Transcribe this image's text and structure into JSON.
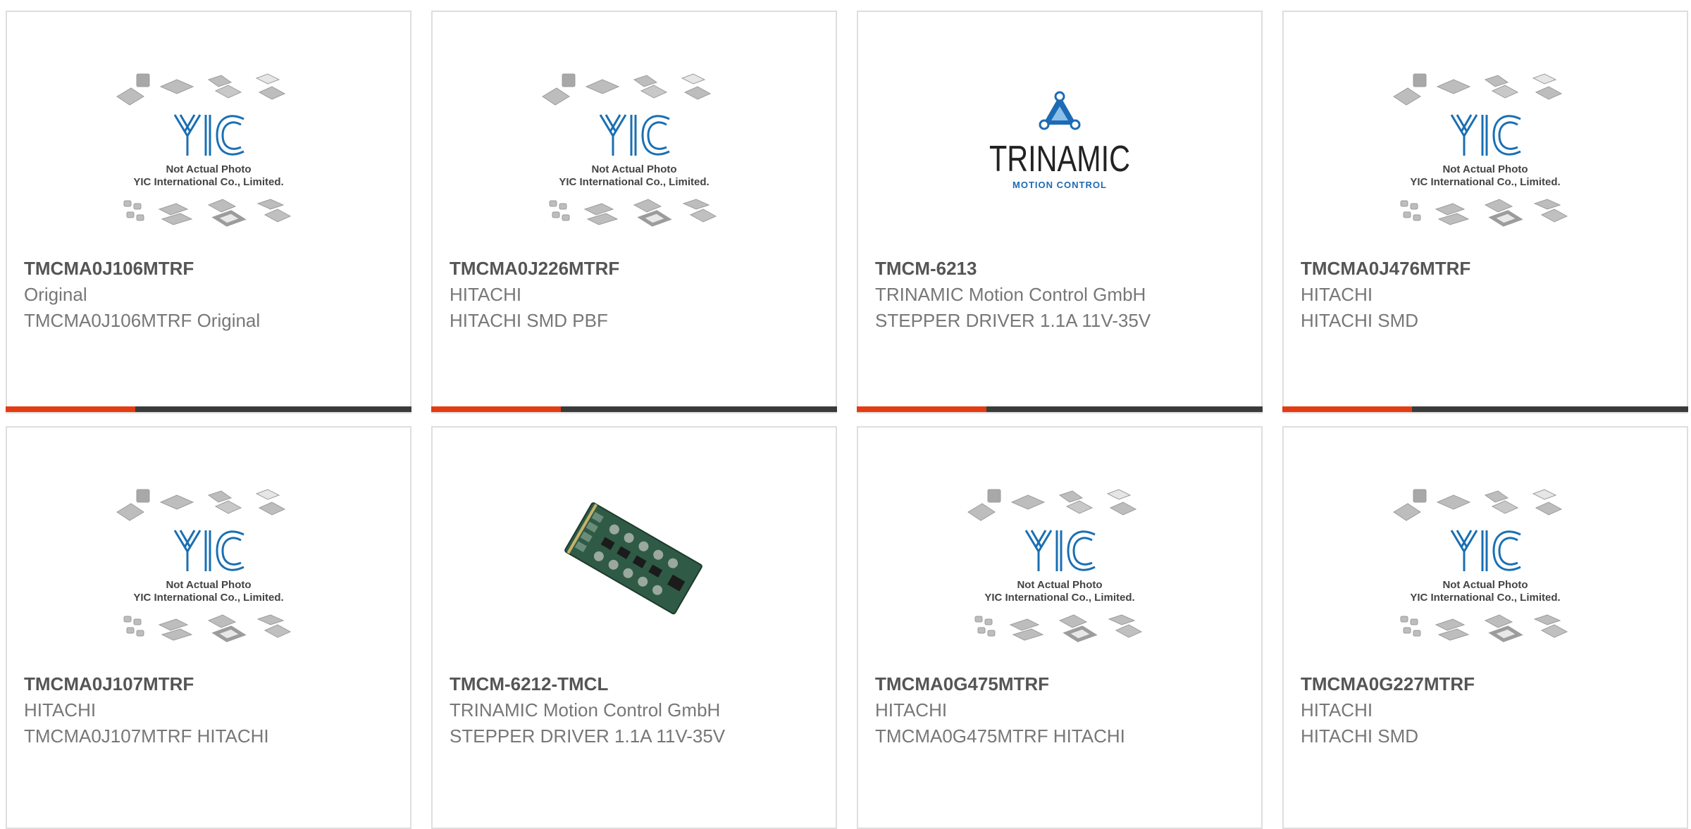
{
  "colors": {
    "accent": "#e43c12",
    "bar": "#3b3b3b",
    "title": "#555555",
    "text": "#777777",
    "yic_blue": "#1a6fb3",
    "trinamic_blue": "#1d6bb4"
  },
  "placeholder_image": {
    "icon": "yic-placeholder-chips-icon",
    "caption_line1": "Not Actual Photo",
    "caption_line2": "YIC International Co., Limited."
  },
  "trinamic_logo": {
    "icon": "trinamic-logo-icon",
    "word": "TRINAMIC",
    "sub": "MOTION CONTROL"
  },
  "products": [
    {
      "part": "TMCMA0J106MTRF",
      "mfr": "Original",
      "desc": "TMCMA0J106MTRF Original",
      "image": "placeholder"
    },
    {
      "part": "TMCMA0J226MTRF",
      "mfr": "HITACHI",
      "desc": "HITACHI SMD PBF",
      "image": "placeholder"
    },
    {
      "part": "TMCM-6213",
      "mfr": "TRINAMIC Motion Control GmbH",
      "desc": "STEPPER DRIVER 1.1A 11V-35V",
      "image": "trinamic-logo"
    },
    {
      "part": "TMCMA0J476MTRF",
      "mfr": "HITACHI",
      "desc": "HITACHI SMD",
      "image": "placeholder"
    },
    {
      "part": "TMCMA0J107MTRF",
      "mfr": "HITACHI",
      "desc": "TMCMA0J107MTRF HITACHI",
      "image": "placeholder"
    },
    {
      "part": "TMCM-6212-TMCL",
      "mfr": "TRINAMIC Motion Control GmbH",
      "desc": "STEPPER DRIVER 1.1A 11V-35V",
      "image": "pcb-board-photo"
    },
    {
      "part": "TMCMA0G475MTRF",
      "mfr": "HITACHI",
      "desc": "TMCMA0G475MTRF HITACHI",
      "image": "placeholder"
    },
    {
      "part": "TMCMA0G227MTRF",
      "mfr": "HITACHI",
      "desc": "HITACHI SMD",
      "image": "placeholder"
    }
  ]
}
